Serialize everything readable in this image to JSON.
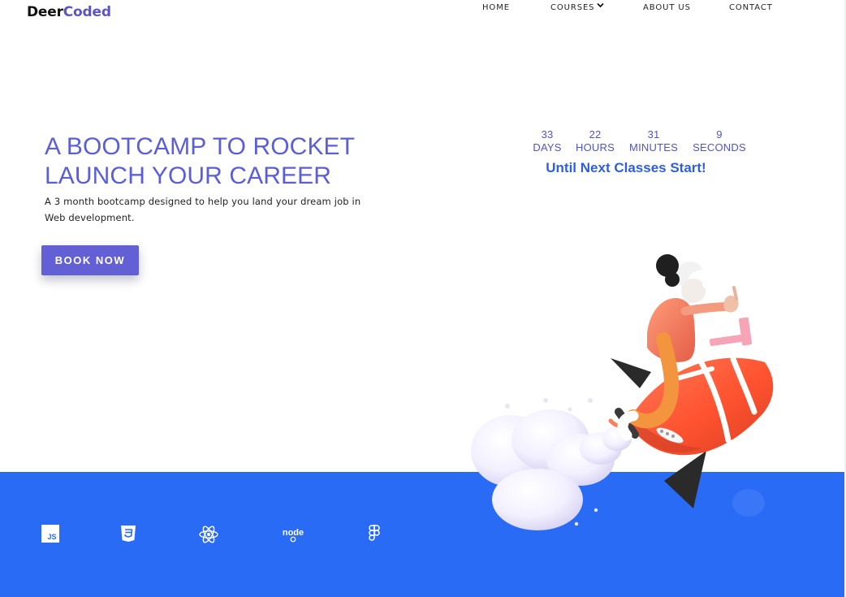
{
  "brand": {
    "logo_part_1": "Deer",
    "logo_part_2": "Coded"
  },
  "nav": {
    "items": [
      {
        "label": "HOME"
      },
      {
        "label": "COURSES",
        "icon": "chevron-down-icon"
      },
      {
        "label": "ABOUT US"
      },
      {
        "label": "CONTACT"
      }
    ]
  },
  "hero": {
    "title_line_1": "A BOOTCAMP TO ROCKET",
    "title_line_2": "LAUNCH YOUR CAREER",
    "description": "A 3 month bootcamp designed to help you land your dream job in Web development.",
    "button_label": "BOOK NOW"
  },
  "countdown": {
    "units": [
      {
        "value": "33",
        "label": "DAYS"
      },
      {
        "value": "22",
        "label": "HOURS"
      },
      {
        "value": "31",
        "label": "MINUTES"
      },
      {
        "value": "9",
        "label": "SECONDS"
      }
    ],
    "caption": "Until Next Classes Start!"
  },
  "tech_stack": {
    "icons": [
      "javascript-icon",
      "css3-icon",
      "react-icon",
      "nodejs-icon",
      "figma-icon"
    ],
    "js_label": "JS",
    "node_label": "node"
  },
  "illustration": {
    "icon": "rocket-illustration"
  },
  "colors": {
    "brand_purple": "#6360d6",
    "heading_blue": "#5a5fd8",
    "countdown_blue": "#2e5fe0",
    "band_blue": "#2a6bf5",
    "rocket_red": "#ff5a36"
  }
}
